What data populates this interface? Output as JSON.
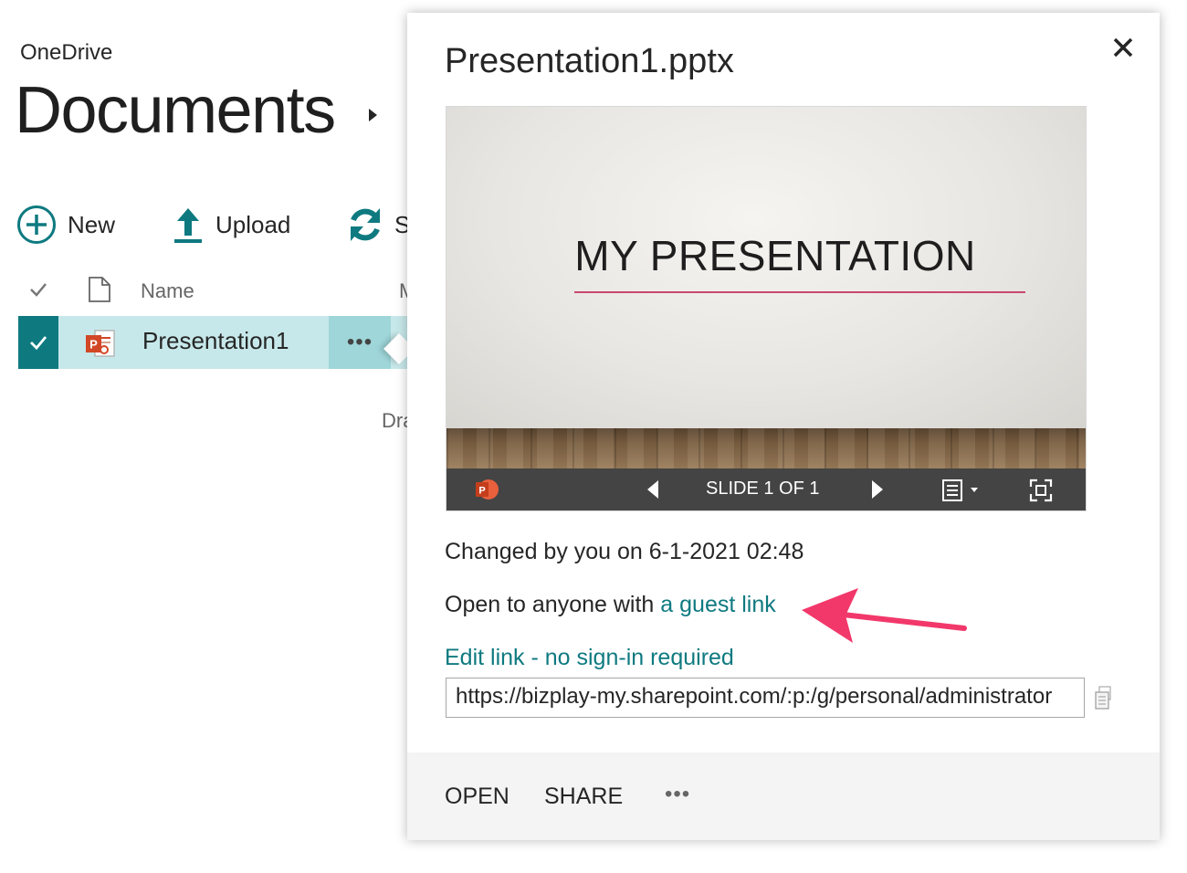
{
  "app": {
    "brand": "OneDrive",
    "page_title": "Documents"
  },
  "commands": {
    "new_label": "New",
    "upload_label": "Upload",
    "sync_label": "S"
  },
  "list": {
    "header_name": "Name",
    "header_modified": "M",
    "rows": [
      {
        "name": "Presentation1",
        "more": "•••",
        "selected": true
      }
    ],
    "drag_hint": "Dra"
  },
  "callout": {
    "file_title": "Presentation1.pptx",
    "preview": {
      "slide_title": "MY PRESENTATION",
      "slide_label": "SLIDE 1 OF 1"
    },
    "changed": "Changed by you on 6-1-2021 02:48",
    "open_text": "Open to anyone with ",
    "guest_link": "a guest link",
    "edit_link": "Edit link - no sign-in required",
    "url": "https://bizplay-my.sharepoint.com/:p:/g/personal/administrator",
    "footer": {
      "open": "OPEN",
      "share": "SHARE",
      "more": "•••"
    }
  },
  "colors": {
    "accent": "#0e7a80",
    "row_selected": "#c7e8ea",
    "arrow": "#f2386b",
    "ppt_red": "#d24726"
  },
  "icons": [
    "plus-circle-icon",
    "upload-icon",
    "sync-icon",
    "check-icon",
    "file-icon",
    "powerpoint-icon",
    "close-icon",
    "copy-icon",
    "prev-slide-icon",
    "next-slide-icon",
    "notes-icon",
    "fullscreen-icon"
  ]
}
